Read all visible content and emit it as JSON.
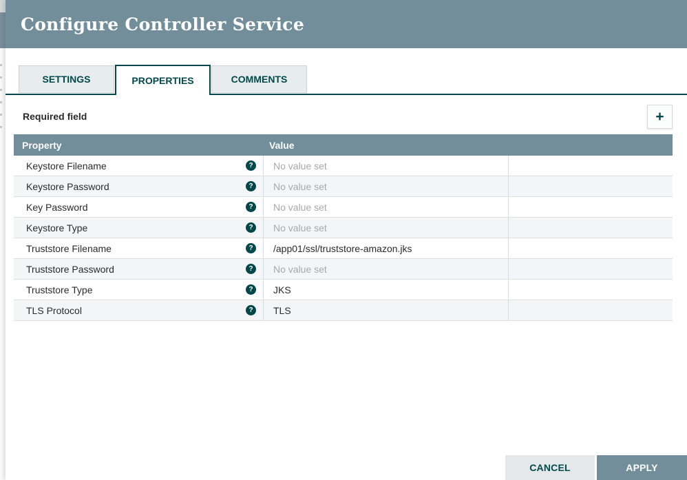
{
  "dialog": {
    "title": "Configure Controller Service",
    "tabs": [
      {
        "label": "SETTINGS",
        "active": false
      },
      {
        "label": "PROPERTIES",
        "active": true
      },
      {
        "label": "COMMENTS",
        "active": false
      }
    ],
    "properties_panel": {
      "required_field_label": "Required field",
      "table": {
        "columns": [
          "Property",
          "Value"
        ],
        "rows": [
          {
            "property": "Keystore Filename",
            "value": "No value set",
            "unset": true
          },
          {
            "property": "Keystore Password",
            "value": "No value set",
            "unset": true
          },
          {
            "property": "Key Password",
            "value": "No value set",
            "unset": true
          },
          {
            "property": "Keystore Type",
            "value": "No value set",
            "unset": true
          },
          {
            "property": "Truststore Filename",
            "value": "/app01/ssl/truststore-amazon.jks",
            "unset": false
          },
          {
            "property": "Truststore Password",
            "value": "No value set",
            "unset": true
          },
          {
            "property": "Truststore Type",
            "value": "JKS",
            "unset": false
          },
          {
            "property": "TLS Protocol",
            "value": "TLS",
            "unset": false
          }
        ]
      }
    },
    "footer": {
      "cancel_label": "CANCEL",
      "apply_label": "APPLY"
    },
    "icons": {
      "add_glyph": "+",
      "help_glyph": "?"
    },
    "colors": {
      "header_bg": "#728e9b",
      "accent_teal": "#004849",
      "row_alt_bg": "#f3f5f7",
      "row_border": "#dcdfe2",
      "unset_text": "#a8a8a8",
      "cancel_bg": "#e4e8eb"
    }
  }
}
